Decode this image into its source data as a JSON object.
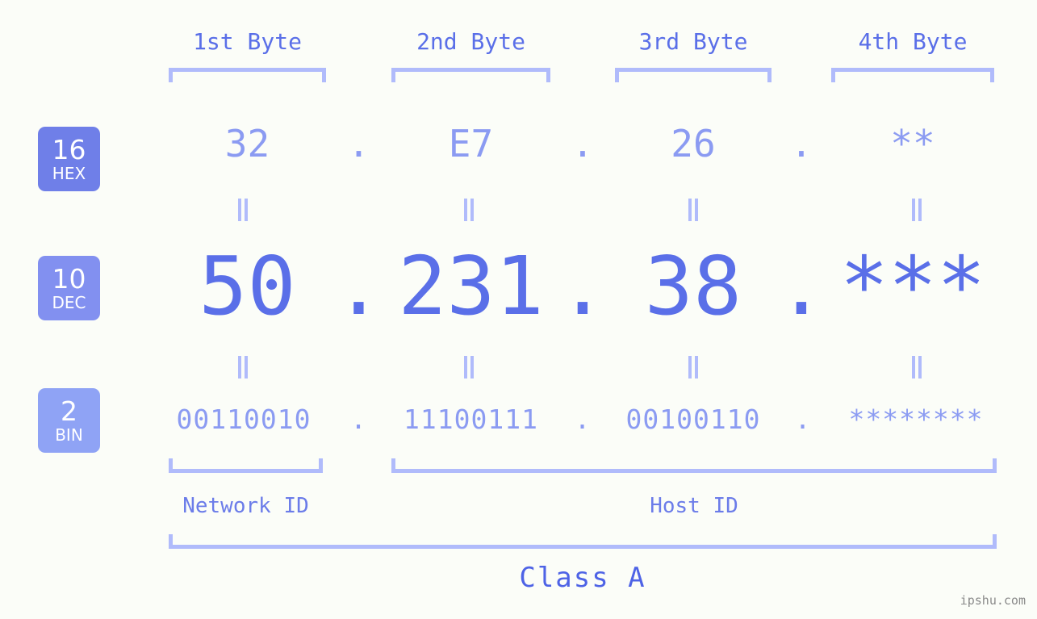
{
  "meta": {
    "accent_strong": "#5a6fe8",
    "accent_mid": "#8b9bf2",
    "accent_light": "#b0bbfb",
    "background": "#fbfdf8",
    "watermark": "ipshu.com"
  },
  "headers": [
    {
      "label": "1st Byte"
    },
    {
      "label": "2nd Byte"
    },
    {
      "label": "3rd Byte"
    },
    {
      "label": "4th Byte"
    }
  ],
  "bases": [
    {
      "num": "16",
      "name": "HEX",
      "color": "#6f7fe8"
    },
    {
      "num": "10",
      "name": "DEC",
      "color": "#8290f0"
    },
    {
      "num": "2",
      "name": "BIN",
      "color": "#8fa3f5"
    }
  ],
  "rows": {
    "hex": {
      "values": [
        "32",
        "E7",
        "26",
        "**"
      ],
      "separator": "."
    },
    "dec": {
      "values": [
        "50",
        "231",
        "38",
        "***"
      ],
      "separator": "."
    },
    "bin": {
      "values": [
        "00110010",
        "11100111",
        "00100110",
        "********"
      ],
      "separator": "."
    }
  },
  "equivalence_mark": "=",
  "sections": [
    {
      "label": "Network ID"
    },
    {
      "label": "Host ID"
    }
  ],
  "class": {
    "label": "Class A"
  }
}
